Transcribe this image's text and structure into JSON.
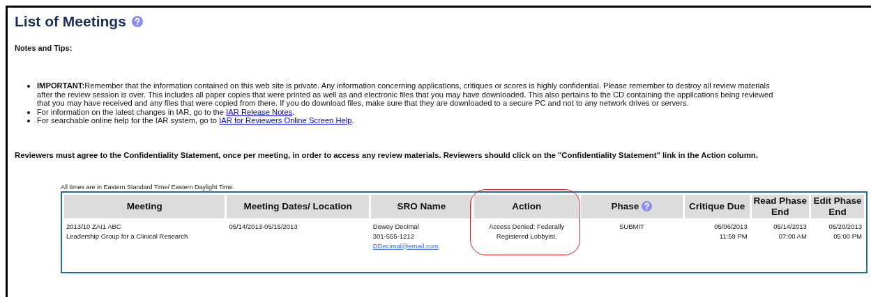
{
  "page": {
    "title": "List of Meetings",
    "notes_heading": "Notes and Tips:",
    "notes": [
      {
        "text": "**IMPORTANT:**Remember that the information contained on this web site is private. Any information concerning applications, critiques or scores is highly confidential. Please remember to destroy all review materials after the review session is over. This includes all paper copies that were printed as well as and electronic files that you may have downloaded. This also pertains to the CD containing the applications being reviewed that you may have received and any files that were copied from there. If you do download files, make sure that they are downloaded to a secure PC and not to any network drives or servers."
      },
      {
        "text": "For information on the latest changes in IAR, go to the ",
        "link": "IAR Release Notes",
        "after": "."
      },
      {
        "text": "For searchable online help for the IAR system, go to ",
        "link": "IAR for Reviewers Online Screen Help",
        "after": "."
      }
    ],
    "statement": "Reviewers must agree to the Confidentiality Statement, once per meeting, in order to access any review materials.  Reviewers should click on the \"Confidentiality Statement\" link in the Action column.",
    "time_note": "All times are in Eastern Standard Time/ Eastern Daylight Time."
  },
  "table": {
    "columns": [
      {
        "label": "Meeting",
        "help": false,
        "highlighted": false
      },
      {
        "label": "Meeting Dates/ Location",
        "help": false,
        "highlighted": false
      },
      {
        "label": "SRO Name",
        "help": false,
        "highlighted": false
      },
      {
        "label": "Action",
        "help": false,
        "highlighted": true
      },
      {
        "label": "Phase",
        "help": true,
        "highlighted": false
      },
      {
        "label": "Critique Due",
        "help": false,
        "highlighted": false
      },
      {
        "label": "Read Phase End",
        "help": false,
        "highlighted": false
      },
      {
        "label": "Edit Phase End",
        "help": false,
        "highlighted": false
      }
    ],
    "rows": [
      {
        "cells": [
          {
            "lines": [
              {
                "text": "2013/10 ZAI1 ABC"
              },
              {
                "text": "Leadership Group for a Clinical Research"
              }
            ]
          },
          {
            "lines": [
              {
                "text": "05/14/2013-05/15/2013"
              }
            ]
          },
          {
            "lines": [
              {
                "text": "Dewey Decimal"
              },
              {
                "text": "301-555-1212"
              },
              {
                "text": "DDecimal@email.com",
                "kind": "link"
              }
            ]
          },
          {
            "lines": [
              {
                "text": "Access Denied: Federally Registered Lobbyist."
              }
            ]
          },
          {
            "lines": [
              {
                "text": "SUBMIT"
              }
            ]
          },
          {
            "lines": [
              {
                "text": "05/06/2013"
              },
              {
                "text": "11:59 PM"
              }
            ]
          },
          {
            "lines": [
              {
                "text": "05/14/2013"
              },
              {
                "text": "07:00 AM"
              }
            ]
          },
          {
            "lines": [
              {
                "text": "05/20/2013"
              },
              {
                "text": "05:00 PM"
              }
            ]
          }
        ]
      }
    ]
  }
}
